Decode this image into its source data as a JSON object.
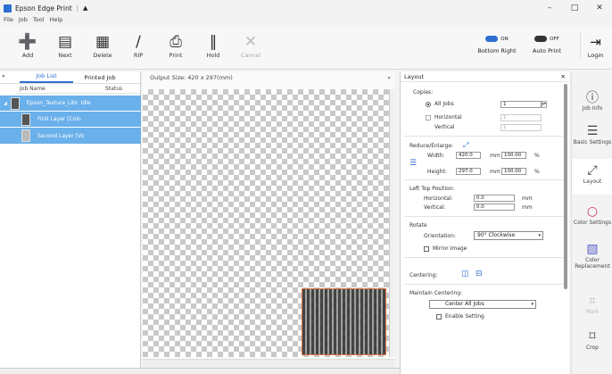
{
  "window": {
    "title": "Epson Edge Print",
    "pin": "▲",
    "controls": [
      "–",
      "□",
      "✕"
    ]
  },
  "menu": [
    "File",
    "Job",
    "Tool",
    "Help"
  ],
  "toolbar": {
    "add": "Add",
    "next": "Next",
    "delete": "Delete",
    "rip": "RIP",
    "print": "Print",
    "hold": "Hold",
    "cancel": "Cancel",
    "toggle_on": "ON",
    "toggle_off": "OFF",
    "bottom_right": "Bottom Right",
    "auto_print": "Auto Print",
    "login": "Login"
  },
  "left": {
    "collapse": "»",
    "tab_job_list": "Job List",
    "tab_printed_job": "Printed Job",
    "col_job_name": "Job Name",
    "col_status": "Status",
    "jobs": [
      {
        "name": "Epson_Texture_Libr. Idle"
      },
      {
        "name": "First Layer [Colo"
      },
      {
        "name": "Second Layer [Vo"
      }
    ]
  },
  "canvas": {
    "output_size": "Output Size:  420 x 297(mm)",
    "collapse": "»"
  },
  "layout": {
    "title": "Layout",
    "close": "✕",
    "copies": "Copies:",
    "all_jobs": "All Jobs",
    "all_jobs_value": "1",
    "horizontal": "Horizontal",
    "vertical": "Vertical",
    "h_value": "1",
    "v_value": "1",
    "reduce": "Reduce/Enlarge:",
    "width": "Width:",
    "width_value": "420.0",
    "height": "Height:",
    "height_value": "297.0",
    "mm": "mm",
    "pct": "%",
    "width_pct": "100.00",
    "height_pct": "100.00",
    "left_top": "Left Top Position:",
    "lt_horizontal": "Horizontal:",
    "lt_vertical": "Vertical:",
    "lt_h_value": "0.0",
    "lt_v_value": "0.0",
    "rotate": "Rotate",
    "orientation": "Orientation:",
    "orientation_value": "90° Clockwise",
    "mirror": "Mirror Image",
    "centering": "Centering:",
    "maintain": "Maintain Centering:",
    "center_all": "Center All Jobs",
    "enable": "Enable Setting"
  },
  "sidebar": [
    "Job Info",
    "Basic Settings",
    "Layout",
    "Color Settings",
    "Color Replacement",
    "Mark",
    "Crop"
  ]
}
